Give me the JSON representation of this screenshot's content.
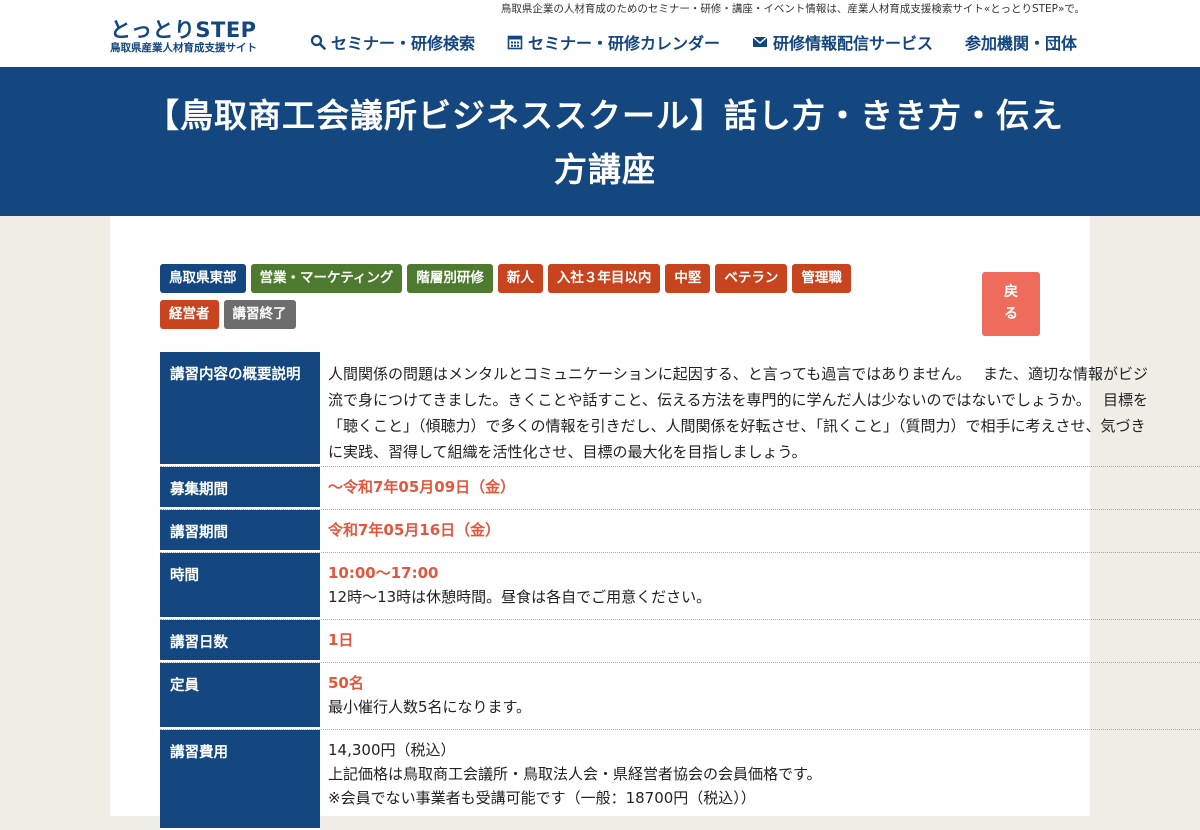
{
  "header": {
    "tagline": "鳥取県企業の人材育成のためのセミナー・研修・講座・イベント情報は、産業人材育成支援検索サイト«とっとりSTEP»で。",
    "logo_main": "とっとりSTEP",
    "logo_sub": "鳥取県産業人材育成支援サイト",
    "nav": [
      {
        "label": "セミナー・研修検索",
        "icon": "search-icon"
      },
      {
        "label": "セミナー・研修カレンダー",
        "icon": "calendar-icon"
      },
      {
        "label": "研修情報配信サービス",
        "icon": "mail-icon"
      },
      {
        "label": "参加機関・団体",
        "icon": ""
      }
    ]
  },
  "title_lines": [
    "【鳥取商工会議所ビジネススクール】話し方・きき方・伝え",
    "方講座"
  ],
  "tags": [
    {
      "label": "鳥取県東部",
      "color": "#14477f"
    },
    {
      "label": "営業・マーケティング",
      "color": "#4e7a2f"
    },
    {
      "label": "階層別研修",
      "color": "#4e7a2f"
    },
    {
      "label": "新人",
      "color": "#c8441e"
    },
    {
      "label": "入社３年目以内",
      "color": "#c8441e"
    },
    {
      "label": "中堅",
      "color": "#c8441e"
    },
    {
      "label": "ベテラン",
      "color": "#c8441e"
    },
    {
      "label": "管理職",
      "color": "#c8441e"
    },
    {
      "label": "経営者",
      "color": "#c8441e"
    },
    {
      "label": "講習終了",
      "color": "#6d6d6d"
    }
  ],
  "back_button": [
    "戻",
    "る"
  ],
  "details": {
    "overview": {
      "label": "講習内容の概要説明",
      "lines": [
        "人間関係の問題はメンタルとコミュニケーションに起因する、と言っても過言ではありません。　 また、適切な情報がビジ",
        "流で身につけてきました。きくことや話すこと、伝える方法を専門的に学んだ人は少ないのではないでしょうか。　 目標を",
        "「聴くこと」（傾聴力）で多くの情報を引きだし、人間関係を好転させ、「訊くこと」（質問力）で相手に考えさせ、気づき",
        "に実践、習得して組織を活性化させ、目標の最大化を目指しましょう。"
      ]
    },
    "recruit": {
      "label": "募集期間",
      "value": "～令和7年05月09日（金）"
    },
    "course": {
      "label": "講習期間",
      "value": "令和7年05月16日（金）"
    },
    "time": {
      "label": "時間",
      "value": "10:00〜17:00",
      "note": "12時〜13時は休憩時間。昼食は各自でご用意ください。"
    },
    "days": {
      "label": "講習日数",
      "value": "1日"
    },
    "capacity": {
      "label": "定員",
      "value": "50名",
      "note": "最小催行人数5名になります。"
    },
    "fee": {
      "label": "講習費用",
      "lines": [
        "14,300円（税込）",
        "上記価格は鳥取商工会議所・鳥取法人会・県経営者協会の会員価格です。",
        "※会員でない事業者も受講可能です（一般：18700円（税込））"
      ]
    }
  }
}
